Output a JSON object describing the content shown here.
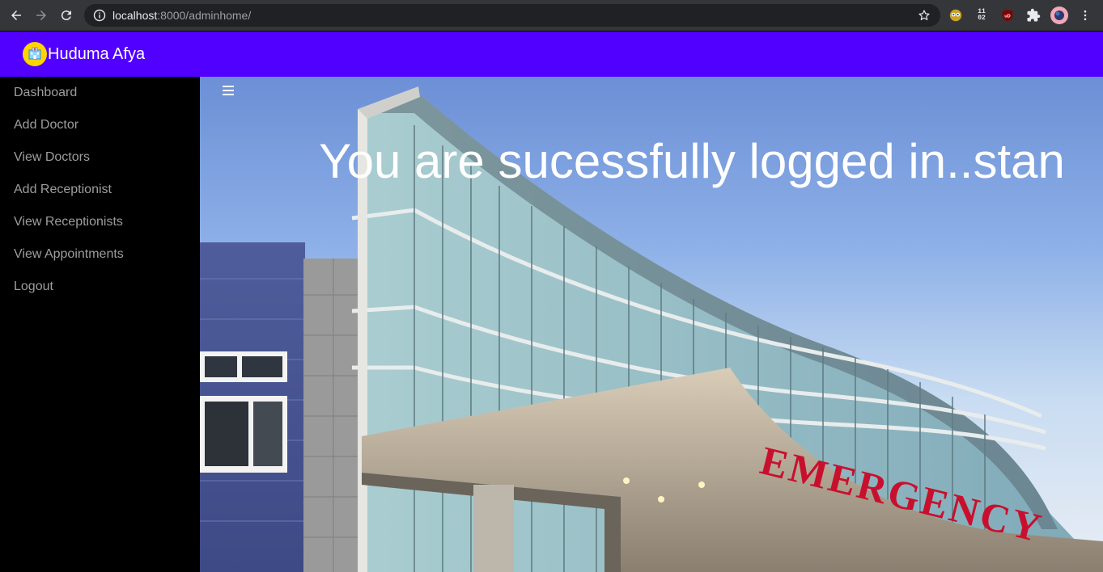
{
  "browser": {
    "url_host": "localhost",
    "url_rest": ":8000/adminhome/",
    "clock_ext": [
      "11",
      "02"
    ],
    "ublock_label": "uD"
  },
  "header": {
    "brand": "Huduma Afya",
    "bg_color": "#5100ff"
  },
  "sidebar": {
    "items": [
      {
        "label": "Dashboard"
      },
      {
        "label": "Add Doctor"
      },
      {
        "label": "View Doctors"
      },
      {
        "label": "Add Receptionist"
      },
      {
        "label": "View Receptionists"
      },
      {
        "label": "View Appointments"
      },
      {
        "label": "Logout"
      }
    ]
  },
  "main": {
    "welcome": "You are sucessfully logged in..stan",
    "sign_text": "EMERGENCY"
  }
}
